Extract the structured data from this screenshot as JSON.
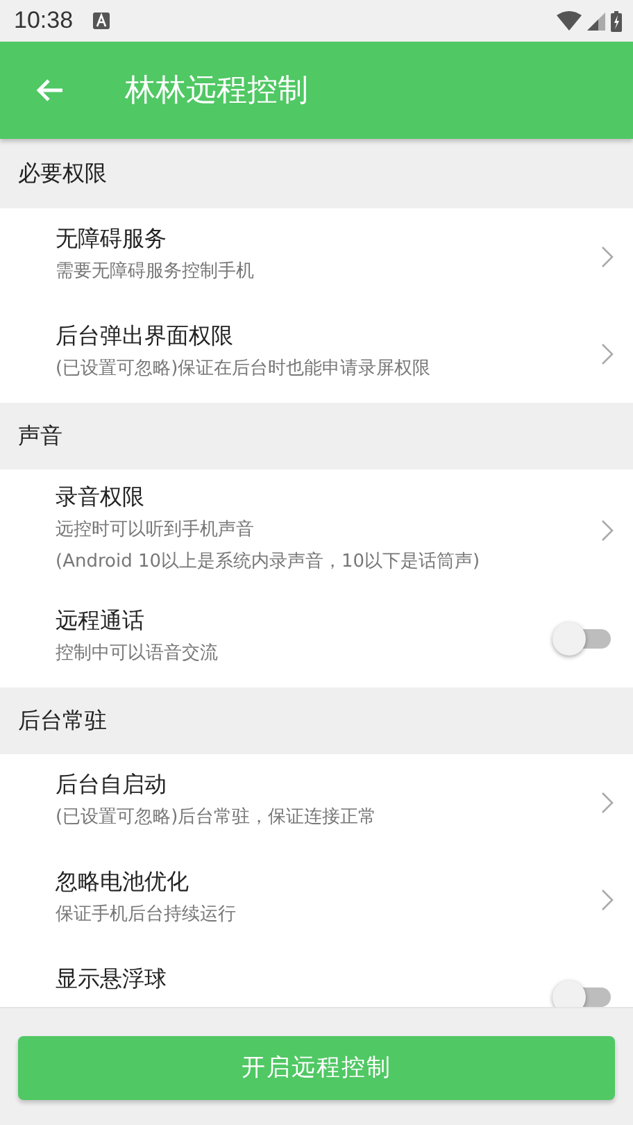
{
  "status_bar": {
    "time": "10:38"
  },
  "app_bar": {
    "title": "林林远程控制"
  },
  "sections": [
    {
      "title": "必要权限",
      "items": [
        {
          "kind": "link",
          "title": "无障碍服务",
          "lines": [
            "需要无障碍服务控制手机"
          ]
        },
        {
          "kind": "link",
          "title": "后台弹出界面权限",
          "lines": [
            "(已设置可忽略)保证在后台时也能申请录屏权限"
          ]
        }
      ]
    },
    {
      "title": "声音",
      "items": [
        {
          "kind": "link",
          "title": "录音权限",
          "lines": [
            "远控时可以听到手机声音",
            "(Android 10以上是系统内录声音，10以下是话筒声)"
          ]
        },
        {
          "kind": "switch",
          "title": "远程通话",
          "lines": [
            "控制中可以语音交流"
          ],
          "on": false
        }
      ]
    },
    {
      "title": "后台常驻",
      "items": [
        {
          "kind": "link",
          "title": "后台自启动",
          "lines": [
            "(已设置可忽略)后台常驻，保证连接正常"
          ]
        },
        {
          "kind": "link",
          "title": "忽略电池优化",
          "lines": [
            "保证手机后台持续运行"
          ]
        },
        {
          "kind": "switch",
          "title": "显示悬浮球",
          "on": false
        }
      ]
    }
  ],
  "action_button": {
    "label": "开启远程控制"
  }
}
